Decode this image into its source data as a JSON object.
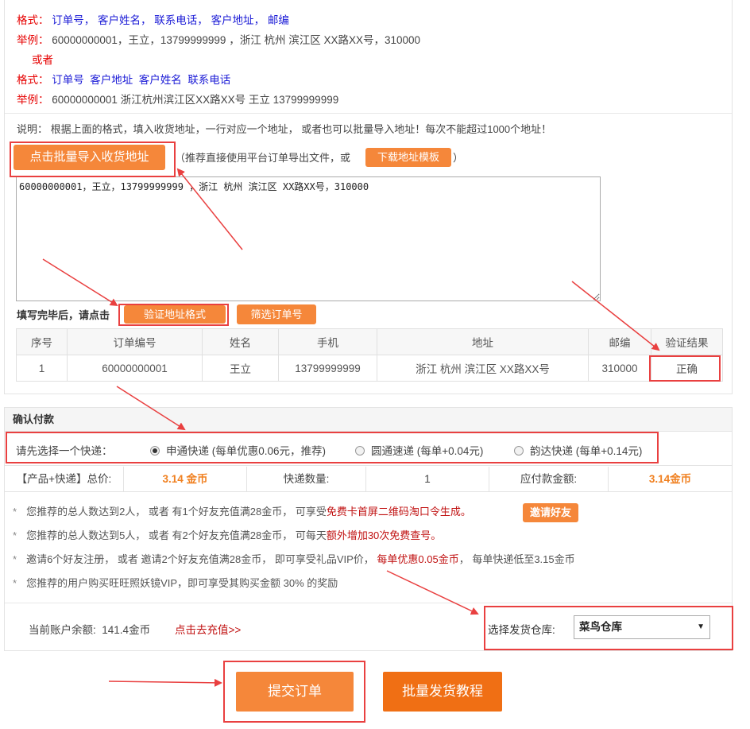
{
  "format1": {
    "label": "格式：",
    "fields": [
      "订单号",
      "客户姓名",
      "联系电话",
      "客户地址",
      "邮编"
    ],
    "example_label": "举例：",
    "example": "60000000001，王立，13799999999 ，浙江 杭州 滨江区 XX路XX号，310000"
  },
  "or_text": "或者",
  "format2": {
    "label": "格式：",
    "fields": [
      "订单号",
      "客户地址",
      "客户姓名",
      "联系电话"
    ],
    "example_label": "举例：",
    "example": "60000000001 浙江杭州滨江区XX路XX号 王立 13799999999"
  },
  "note": "说明：  根据上面的格式，填入收货地址，一行对应一个地址，  或者也可以批量导入地址！每次不能超过1000个地址！",
  "import": {
    "button": "点击批量导入收货地址",
    "hint_prefix": "（推荐直接使用平台订单导出文件，或",
    "template_button": "下载地址模板",
    "hint_suffix": "）"
  },
  "textarea_value": "60000000001，王立，13799999999 ，浙江 杭州 滨江区 XX路XX号，310000",
  "verify": {
    "label": "填写完毕后，请点击",
    "verify_button": "验证地址格式",
    "filter_button": "筛选订单号"
  },
  "table": {
    "headers": [
      "序号",
      "订单编号",
      "姓名",
      "手机",
      "地址",
      "邮编",
      "验证结果"
    ],
    "rows": [
      [
        "1",
        "60000000001",
        "王立",
        "13799999999",
        "浙江 杭州 滨江区 XX路XX号",
        "310000",
        "正确"
      ]
    ]
  },
  "payment": {
    "title": "确认付款",
    "express_label": "请先选择一个快递：",
    "express_options": [
      {
        "label": "申通快递 (每单优惠0.06元，推荐)",
        "selected": true
      },
      {
        "label": "圆通速递 (每单+0.04元)",
        "selected": false
      },
      {
        "label": "韵达快递 (每单+0.14元)",
        "selected": false
      }
    ],
    "summary": {
      "total_label": "【产品+快递】总价:",
      "total_value": "3.14 金币",
      "count_label": "快递数量:",
      "count_value": "1",
      "payable_label": "应付款金额:",
      "payable_value": "3.14金币"
    },
    "promos": [
      {
        "star": "*",
        "text": "您推荐的总人数达到2人，  或者 有1个好友充值满28金币，  可享受",
        "highlight": "免费卡首屏二维码淘口令生成。",
        "suffix": ""
      },
      {
        "star": "*",
        "text": "您推荐的总人数达到5人，  或者 有2个好友充值满28金币，  可每天",
        "highlight": "额外增加30次免费查号。",
        "suffix": ""
      },
      {
        "star": "*",
        "text": "邀请6个好友注册，  或者 邀请2个好友充值满28金币，  即可享受礼品VIP价，  ",
        "highlight": "每单优惠0.05金币",
        "suffix": "，  每单快递低至3.15金币"
      },
      {
        "star": "*",
        "text": "您推荐的用户购买旺旺照妖镜VIP，即可享受其购买金额 30% 的奖励",
        "highlight": "",
        "suffix": ""
      }
    ],
    "invite_button": "邀请好友",
    "balance_label": "当前账户余额:",
    "balance_value": "141.4金币",
    "recharge_link": "点击去充值>>",
    "warehouse_label": "选择发货仓库:",
    "warehouse_value": "菜鸟仓库"
  },
  "actions": {
    "submit": "提交订单",
    "tutorial": "批量发货教程"
  },
  "colors": {
    "accent_orange": "#f5873a",
    "button_orange": "#f06f14",
    "highlight_red": "#e94040",
    "label_red": "#e60000",
    "link_blue": "#1a1ad6",
    "success_green": "#1a8a1a",
    "gold": "#f08020"
  }
}
